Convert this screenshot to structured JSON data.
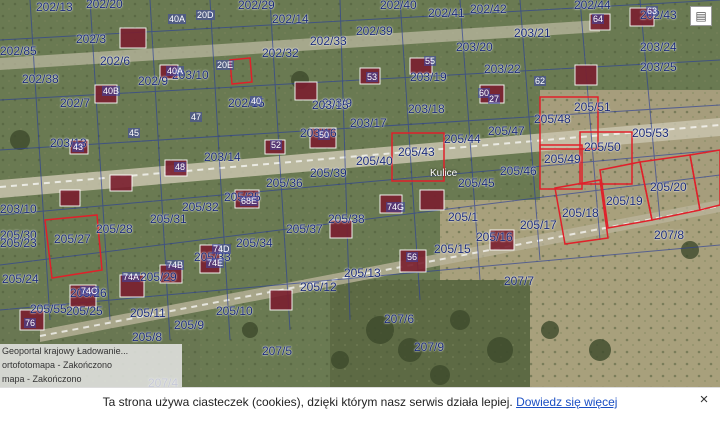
{
  "parcel_labels": [
    "202/13",
    "202/20",
    "202/29",
    "202/14",
    "202/40",
    "202/41",
    "202/42",
    "202/44",
    "202/43",
    "202/3",
    "202/6",
    "202/33",
    "202/39",
    "203/20",
    "203/21",
    "203/24",
    "203/25",
    "202/85",
    "202/38",
    "202/9",
    "203/10",
    "202/32",
    "203/22",
    "202/7",
    "202/15",
    "203/9",
    "203/17",
    "203/18",
    "205/44",
    "205/47",
    "205/48",
    "205/51",
    "205/53",
    "203/13",
    "203/16",
    "205/43",
    "205/49",
    "205/50",
    "203/14",
    "205/40",
    "205/46",
    "203/15",
    "203/19",
    "205/36",
    "205/39",
    "203/10",
    "205/30",
    "205/31",
    "205/32",
    "205/35",
    "205/38",
    "205/37",
    "205/33",
    "205/34",
    "205/1",
    "205/45",
    "205/20",
    "205/19",
    "205/18",
    "205/17",
    "205/23",
    "205/27",
    "205/28",
    "205/29",
    "205/15",
    "205/16",
    "205/13",
    "205/12",
    "207/8",
    "205/24",
    "205/26",
    "205/25",
    "205/55",
    "205/9",
    "205/10",
    "205/11",
    "205/8",
    "207/7",
    "207/6",
    "207/9",
    "207/5",
    "207/4"
  ],
  "building_labels": [
    "40A",
    "20D",
    "40B",
    "40A",
    "20E",
    "40",
    "53",
    "55",
    "62",
    "64",
    "63",
    "47",
    "45",
    "43",
    "52",
    "60",
    "27",
    "50",
    "48",
    "68E",
    "74G",
    "74D",
    "74E",
    "74B",
    "74A",
    "74C",
    "56",
    "76"
  ],
  "place_label": "Kulice",
  "status_panel": {
    "line1": "Geoportal krajowy   Ładowanie...",
    "line2": "ortofotomapa - Zakończono",
    "line3": "mapa - Zakończono"
  },
  "cookie_banner": {
    "text": "Ta strona używa ciasteczek (cookies), dzięki którym nasz serwis działa lepiej.",
    "link": "Dowiedz się więcej",
    "close": "×"
  },
  "controls": {
    "legend_icon": "layers-icon"
  }
}
